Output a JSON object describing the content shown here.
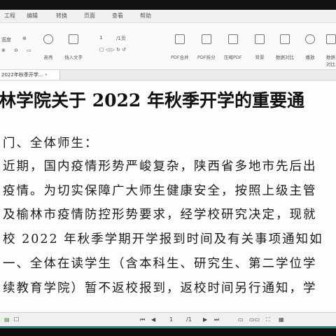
{
  "menu": [
    "工程",
    "编辑",
    "转换",
    "页面",
    "查看",
    "帮助"
  ],
  "toolbar": {
    "zoom_label": "宽度",
    "highlight": "高亮",
    "insert_text": "插入文字",
    "page_value": "1",
    "page_total": "/1页",
    "pdf_merge": "PDF合并",
    "pdf_split": "PDF拆分",
    "compress": "压缩PDF",
    "background": "背景",
    "doc_compare": "数据对比",
    "play": "播放",
    "more": "数据对比"
  },
  "tab": {
    "title": "2022年秋季开学...",
    "dot": "•"
  },
  "document": {
    "title": "林学院关于 2022 年秋季开学的重要通",
    "lines": [
      "门、全体师生：",
      "近期，国内疫情形势严峻复杂，陕西省多地市先后出",
      "疫情。为切实保障广大师生健康安全，按照上级主管",
      "及榆林市疫情防控形势要求，经学校研究决定，现就",
      "校 2022 年秋季学期开学报到时间及有关事项通知如",
      "一、全体在读学生（含本科生、研究生、第二学位学",
      "续教育学院）暂不返校报到，返校时间另行通知，学"
    ]
  },
  "statusbar": {
    "page_value": "1",
    "page_total": "/1",
    "prev": "◀",
    "next": "▶"
  }
}
